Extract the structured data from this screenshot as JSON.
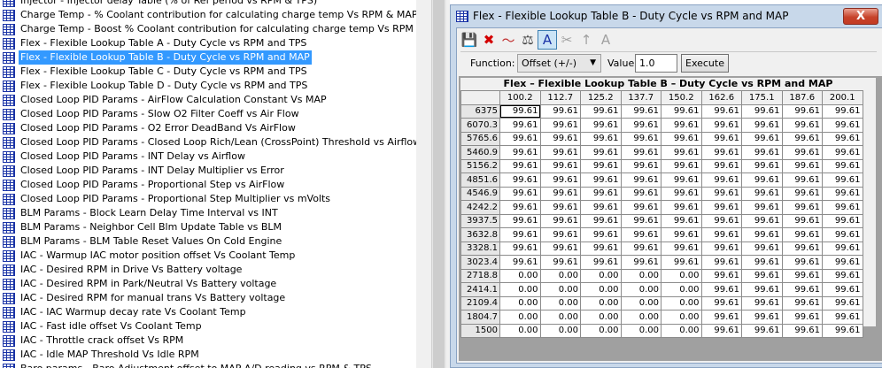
{
  "tree": {
    "items": [
      {
        "label": "Injector - Injector delay Table (% of Ref period vs RPM & TPS)"
      },
      {
        "label": "Charge Temp - % Coolant contribution for calculating charge temp Vs RPM & MAP"
      },
      {
        "label": "Charge Temp - Boost % Coolant contribution for calculating charge temp Vs RPM & MAP"
      },
      {
        "label": "Flex - Flexible Lookup Table A - Duty Cycle vs RPM and TPS"
      },
      {
        "label": "Flex - Flexible Lookup Table B - Duty Cycle vs RPM and MAP",
        "selected": true
      },
      {
        "label": "Flex - Flexible Lookup Table C - Duty Cycle vs RPM and TPS"
      },
      {
        "label": "Flex - Flexible Lookup Table D - Duty Cycle vs RPM and TPS"
      },
      {
        "label": "Closed Loop PID Params - AirFlow Calculation Constant Vs MAP"
      },
      {
        "label": "Closed Loop PID Params - Slow O2 Filter Coeff vs Air Flow"
      },
      {
        "label": "Closed Loop PID Params - O2 Error DeadBand Vs AirFlow"
      },
      {
        "label": "Closed Loop PID Params - Closed Loop Rich/Lean (CrossPoint) Threshold vs Airflow"
      },
      {
        "label": "Closed Loop PID Params - INT Delay vs Airflow"
      },
      {
        "label": "Closed Loop PID Params - INT Delay Multiplier vs Error"
      },
      {
        "label": "Closed Loop PID Params - Proportional Step vs AirFlow"
      },
      {
        "label": "Closed Loop PID Params - Proportional Step Multiplier vs mVolts"
      },
      {
        "label": "BLM Params - Block Learn Delay Time Interval vs INT"
      },
      {
        "label": "BLM Params - Neighbor Cell Blm Update Table  vs BLM"
      },
      {
        "label": "BLM Params - BLM Table Reset Values On Cold Engine"
      },
      {
        "label": "IAC - Warmup IAC motor position offset Vs  Coolant Temp"
      },
      {
        "label": "IAC - Desired RPM in Drive Vs Battery voltage"
      },
      {
        "label": "IAC - Desired RPM in Park/Neutral Vs Battery voltage"
      },
      {
        "label": "IAC - Desired RPM for manual trans Vs Battery voltage"
      },
      {
        "label": "IAC - IAC Warmup decay rate Vs Coolant Temp"
      },
      {
        "label": "IAC - Fast idle offset Vs Coolant Temp"
      },
      {
        "label": "IAC - Throttle crack offset Vs RPM"
      },
      {
        "label": "IAC - Idle MAP Threshold Vs Idle RPM"
      },
      {
        "label": "Baro params - Baro Adjustment offset to MAP A/D reading vs RPM & TPS"
      }
    ]
  },
  "window": {
    "title": "Flex - Flexible Lookup Table B - Duty Cycle vs RPM and MAP",
    "close_label": "X",
    "toolbar": [
      {
        "name": "save-icon",
        "glyph": "💾",
        "color": "#1a1a1a"
      },
      {
        "name": "delete-icon",
        "glyph": "✖",
        "color": "#d40000"
      },
      {
        "name": "graph-icon",
        "glyph": "〜",
        "color": "#c03030"
      },
      {
        "name": "balance-icon",
        "glyph": "⚖",
        "color": "#404040"
      },
      {
        "name": "font-a-icon",
        "glyph": "A",
        "color": "#1a33a6",
        "active": true
      },
      {
        "name": "cut-icon",
        "glyph": "✂",
        "color": "#a0a0a0"
      },
      {
        "name": "merge-icon",
        "glyph": "↑",
        "color": "#a0a0a0"
      },
      {
        "name": "font-a-disabled-icon",
        "glyph": "A",
        "color": "#a0a0a0"
      }
    ],
    "function_label": "Function:",
    "function_value": "Offset (+/-)",
    "value_label": "Value:",
    "value": "1.0",
    "execute_label": "Execute"
  },
  "table": {
    "title": "Flex – Flexible Lookup Table B – Duty Cycle vs RPM and MAP",
    "columns": [
      "100.2",
      "112.7",
      "125.2",
      "137.7",
      "150.2",
      "162.6",
      "175.1",
      "187.6",
      "200.1"
    ],
    "rows": [
      {
        "label": "6375",
        "values": [
          "99.61",
          "99.61",
          "99.61",
          "99.61",
          "99.61",
          "99.61",
          "99.61",
          "99.61",
          "99.61"
        ]
      },
      {
        "label": "6070.3",
        "values": [
          "99.61",
          "99.61",
          "99.61",
          "99.61",
          "99.61",
          "99.61",
          "99.61",
          "99.61",
          "99.61"
        ]
      },
      {
        "label": "5765.6",
        "values": [
          "99.61",
          "99.61",
          "99.61",
          "99.61",
          "99.61",
          "99.61",
          "99.61",
          "99.61",
          "99.61"
        ]
      },
      {
        "label": "5460.9",
        "values": [
          "99.61",
          "99.61",
          "99.61",
          "99.61",
          "99.61",
          "99.61",
          "99.61",
          "99.61",
          "99.61"
        ]
      },
      {
        "label": "5156.2",
        "values": [
          "99.61",
          "99.61",
          "99.61",
          "99.61",
          "99.61",
          "99.61",
          "99.61",
          "99.61",
          "99.61"
        ]
      },
      {
        "label": "4851.6",
        "values": [
          "99.61",
          "99.61",
          "99.61",
          "99.61",
          "99.61",
          "99.61",
          "99.61",
          "99.61",
          "99.61"
        ]
      },
      {
        "label": "4546.9",
        "values": [
          "99.61",
          "99.61",
          "99.61",
          "99.61",
          "99.61",
          "99.61",
          "99.61",
          "99.61",
          "99.61"
        ]
      },
      {
        "label": "4242.2",
        "values": [
          "99.61",
          "99.61",
          "99.61",
          "99.61",
          "99.61",
          "99.61",
          "99.61",
          "99.61",
          "99.61"
        ]
      },
      {
        "label": "3937.5",
        "values": [
          "99.61",
          "99.61",
          "99.61",
          "99.61",
          "99.61",
          "99.61",
          "99.61",
          "99.61",
          "99.61"
        ]
      },
      {
        "label": "3632.8",
        "values": [
          "99.61",
          "99.61",
          "99.61",
          "99.61",
          "99.61",
          "99.61",
          "99.61",
          "99.61",
          "99.61"
        ]
      },
      {
        "label": "3328.1",
        "values": [
          "99.61",
          "99.61",
          "99.61",
          "99.61",
          "99.61",
          "99.61",
          "99.61",
          "99.61",
          "99.61"
        ]
      },
      {
        "label": "3023.4",
        "values": [
          "99.61",
          "99.61",
          "99.61",
          "99.61",
          "99.61",
          "99.61",
          "99.61",
          "99.61",
          "99.61"
        ]
      },
      {
        "label": "2718.8",
        "values": [
          "0.00",
          "0.00",
          "0.00",
          "0.00",
          "0.00",
          "99.61",
          "99.61",
          "99.61",
          "99.61"
        ]
      },
      {
        "label": "2414.1",
        "values": [
          "0.00",
          "0.00",
          "0.00",
          "0.00",
          "0.00",
          "99.61",
          "99.61",
          "99.61",
          "99.61"
        ]
      },
      {
        "label": "2109.4",
        "values": [
          "0.00",
          "0.00",
          "0.00",
          "0.00",
          "0.00",
          "99.61",
          "99.61",
          "99.61",
          "99.61"
        ]
      },
      {
        "label": "1804.7",
        "values": [
          "0.00",
          "0.00",
          "0.00",
          "0.00",
          "0.00",
          "99.61",
          "99.61",
          "99.61",
          "99.61"
        ]
      },
      {
        "label": "1500",
        "values": [
          "0.00",
          "0.00",
          "0.00",
          "0.00",
          "0.00",
          "99.61",
          "99.61",
          "99.61",
          "99.61"
        ]
      }
    ]
  }
}
